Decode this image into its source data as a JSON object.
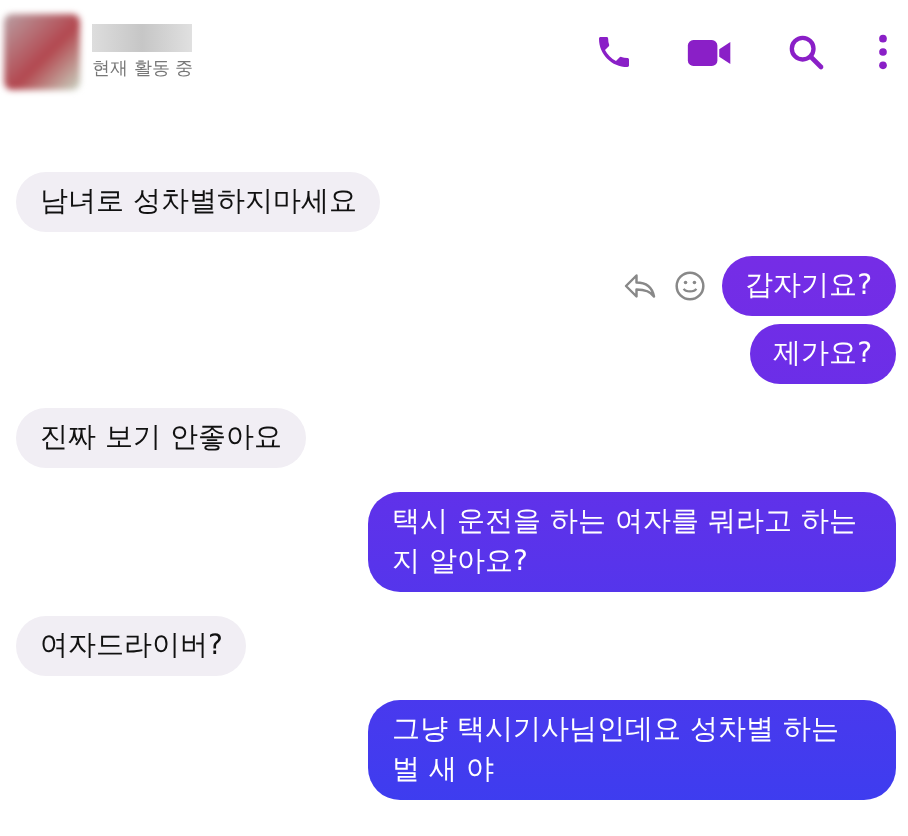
{
  "header": {
    "status": "현재 활동 중"
  },
  "messages": [
    {
      "kind": "received",
      "text": "남녀로 성차별하지마세요",
      "show_actions": false
    },
    {
      "kind": "sent",
      "text": "갑자기요?",
      "show_actions": true
    },
    {
      "kind": "sent",
      "text": "제가요?",
      "show_actions": false
    },
    {
      "kind": "received",
      "text": "진짜 보기 안좋아요",
      "show_actions": false
    },
    {
      "kind": "sent",
      "text": "택시 운전을 하는 여자를 뭐라고 하는지 알아요?",
      "show_actions": false
    },
    {
      "kind": "received",
      "text": "여자드라이버?",
      "show_actions": false
    },
    {
      "kind": "sent",
      "text": "그냥 택시기사님인데요 성차별 하는 벌 새 야",
      "show_actions": false
    }
  ]
}
